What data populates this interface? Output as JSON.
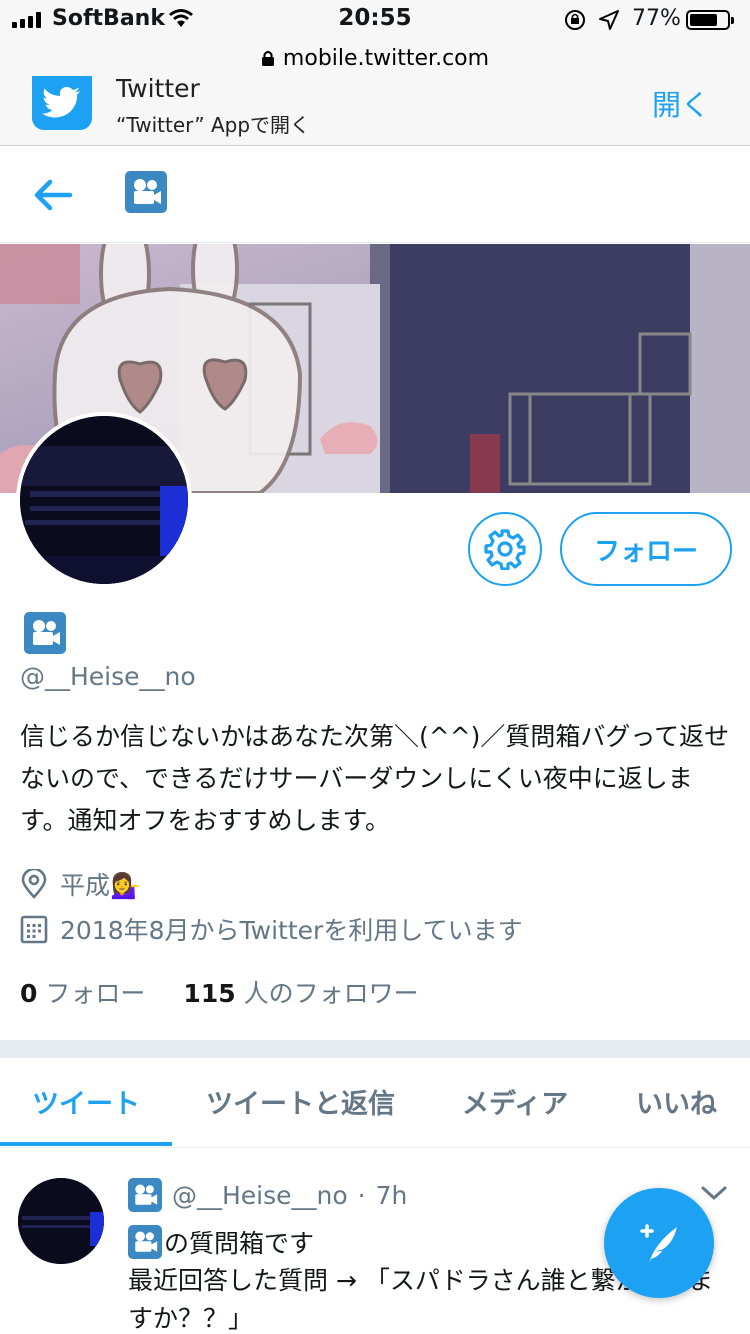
{
  "status_bar": {
    "carrier": "SoftBank",
    "time": "20:55",
    "battery": "77%",
    "battery_level": 0.77
  },
  "browser": {
    "url": "mobile.twitter.com"
  },
  "app_banner": {
    "title": "Twitter",
    "subtitle": "“Twitter” Appで開く",
    "open_label": "開く"
  },
  "profile": {
    "handle": "@__Heise__no",
    "bio": "信じるか信じないかはあなた次第＼(^^)／質問箱バグって返せないので、できるだけサーバーダウンしにくい夜中に返します。通知オフをおすすめします。",
    "location": "平成💁‍♀️",
    "joined": "2018年8月からTwitterを利用しています",
    "follow_label": "フォロー",
    "following_count": "0",
    "following_label": "フォロー",
    "followers_count": "115",
    "followers_label": "人のフォロワー"
  },
  "tabs": [
    {
      "label": "ツイート",
      "active": true
    },
    {
      "label": "ツイートと返信",
      "active": false
    },
    {
      "label": "メディア",
      "active": false
    },
    {
      "label": "いいね",
      "active": false
    }
  ],
  "tweet": {
    "handle": "@__Heise__no",
    "separator": "·",
    "time": "7h",
    "line1": "の質問箱です",
    "line2": "最近回答した質問 → 「スパドラさん誰と繋がってますか？？」"
  },
  "colors": {
    "accent": "#1da1f2",
    "secondary_text": "#657786",
    "emoji_tile": "#3b88c3"
  },
  "icons": [
    "back-arrow-icon",
    "movie-camera-emoji",
    "gear-icon",
    "location-pin-icon",
    "calendar-icon",
    "chevron-down-icon",
    "compose-tweet-icon"
  ]
}
